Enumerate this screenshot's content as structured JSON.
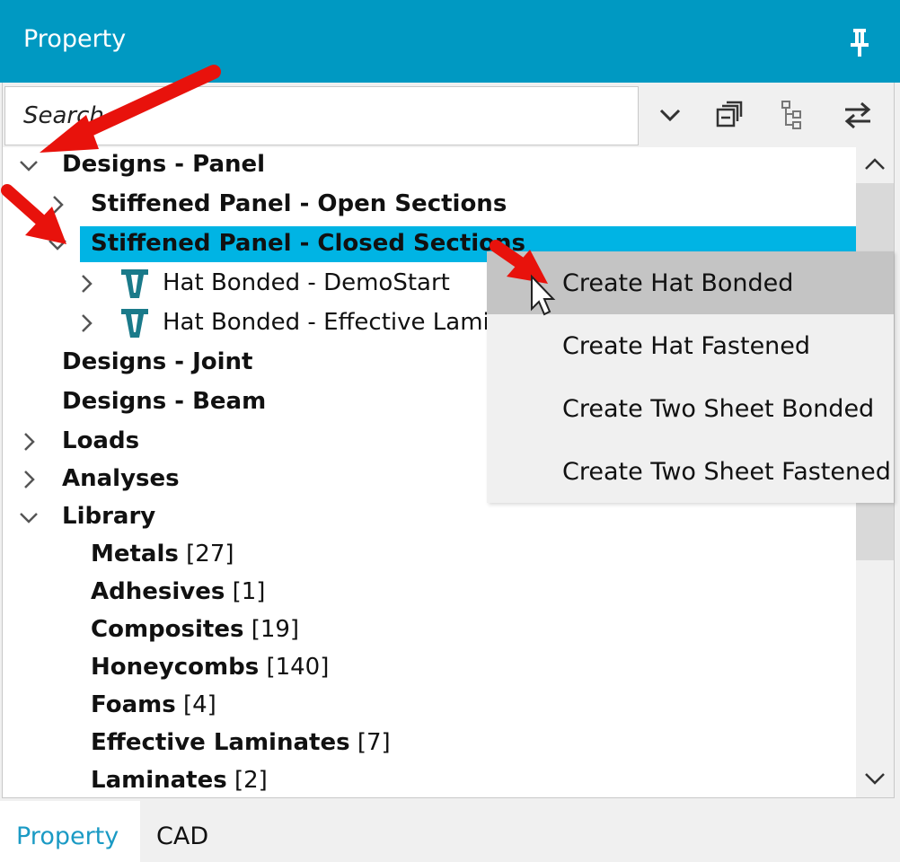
{
  "window": {
    "title": "Property"
  },
  "toolbar": {
    "search_placeholder": "Search"
  },
  "tree": {
    "designs_panel": "Designs - Panel",
    "open_sections": "Stiffened Panel - Open Sections",
    "closed_sections": "Stiffened Panel - Closed Sections",
    "hat_demostart": "Hat Bonded - DemoStart",
    "hat_effective": "Hat Bonded - Effective Laminates",
    "designs_joint": "Designs - Joint",
    "designs_beam": "Designs - Beam",
    "loads": "Loads",
    "analyses": "Analyses",
    "library": "Library",
    "library_items": [
      {
        "label": "Metals",
        "count": "[27]"
      },
      {
        "label": "Adhesives",
        "count": "[1]"
      },
      {
        "label": "Composites",
        "count": "[19]"
      },
      {
        "label": "Honeycombs",
        "count": "[140]"
      },
      {
        "label": "Foams",
        "count": "[4]"
      },
      {
        "label": "Effective Laminates",
        "count": "[7]"
      },
      {
        "label": "Laminates",
        "count": "[2]"
      }
    ]
  },
  "context_menu": {
    "items": [
      "Create Hat Bonded",
      "Create Hat Fastened",
      "Create Two Sheet Bonded",
      "Create Two Sheet Fastened"
    ]
  },
  "tabs": [
    "Property",
    "CAD"
  ],
  "colors": {
    "titlebar": "#0099c2",
    "selection": "#00b4e4",
    "active_tab_text": "#1a9ac4",
    "menu_hover": "#c4c4c4",
    "arrow": "#e8120c",
    "hat_icon": "#1a7a8a"
  }
}
